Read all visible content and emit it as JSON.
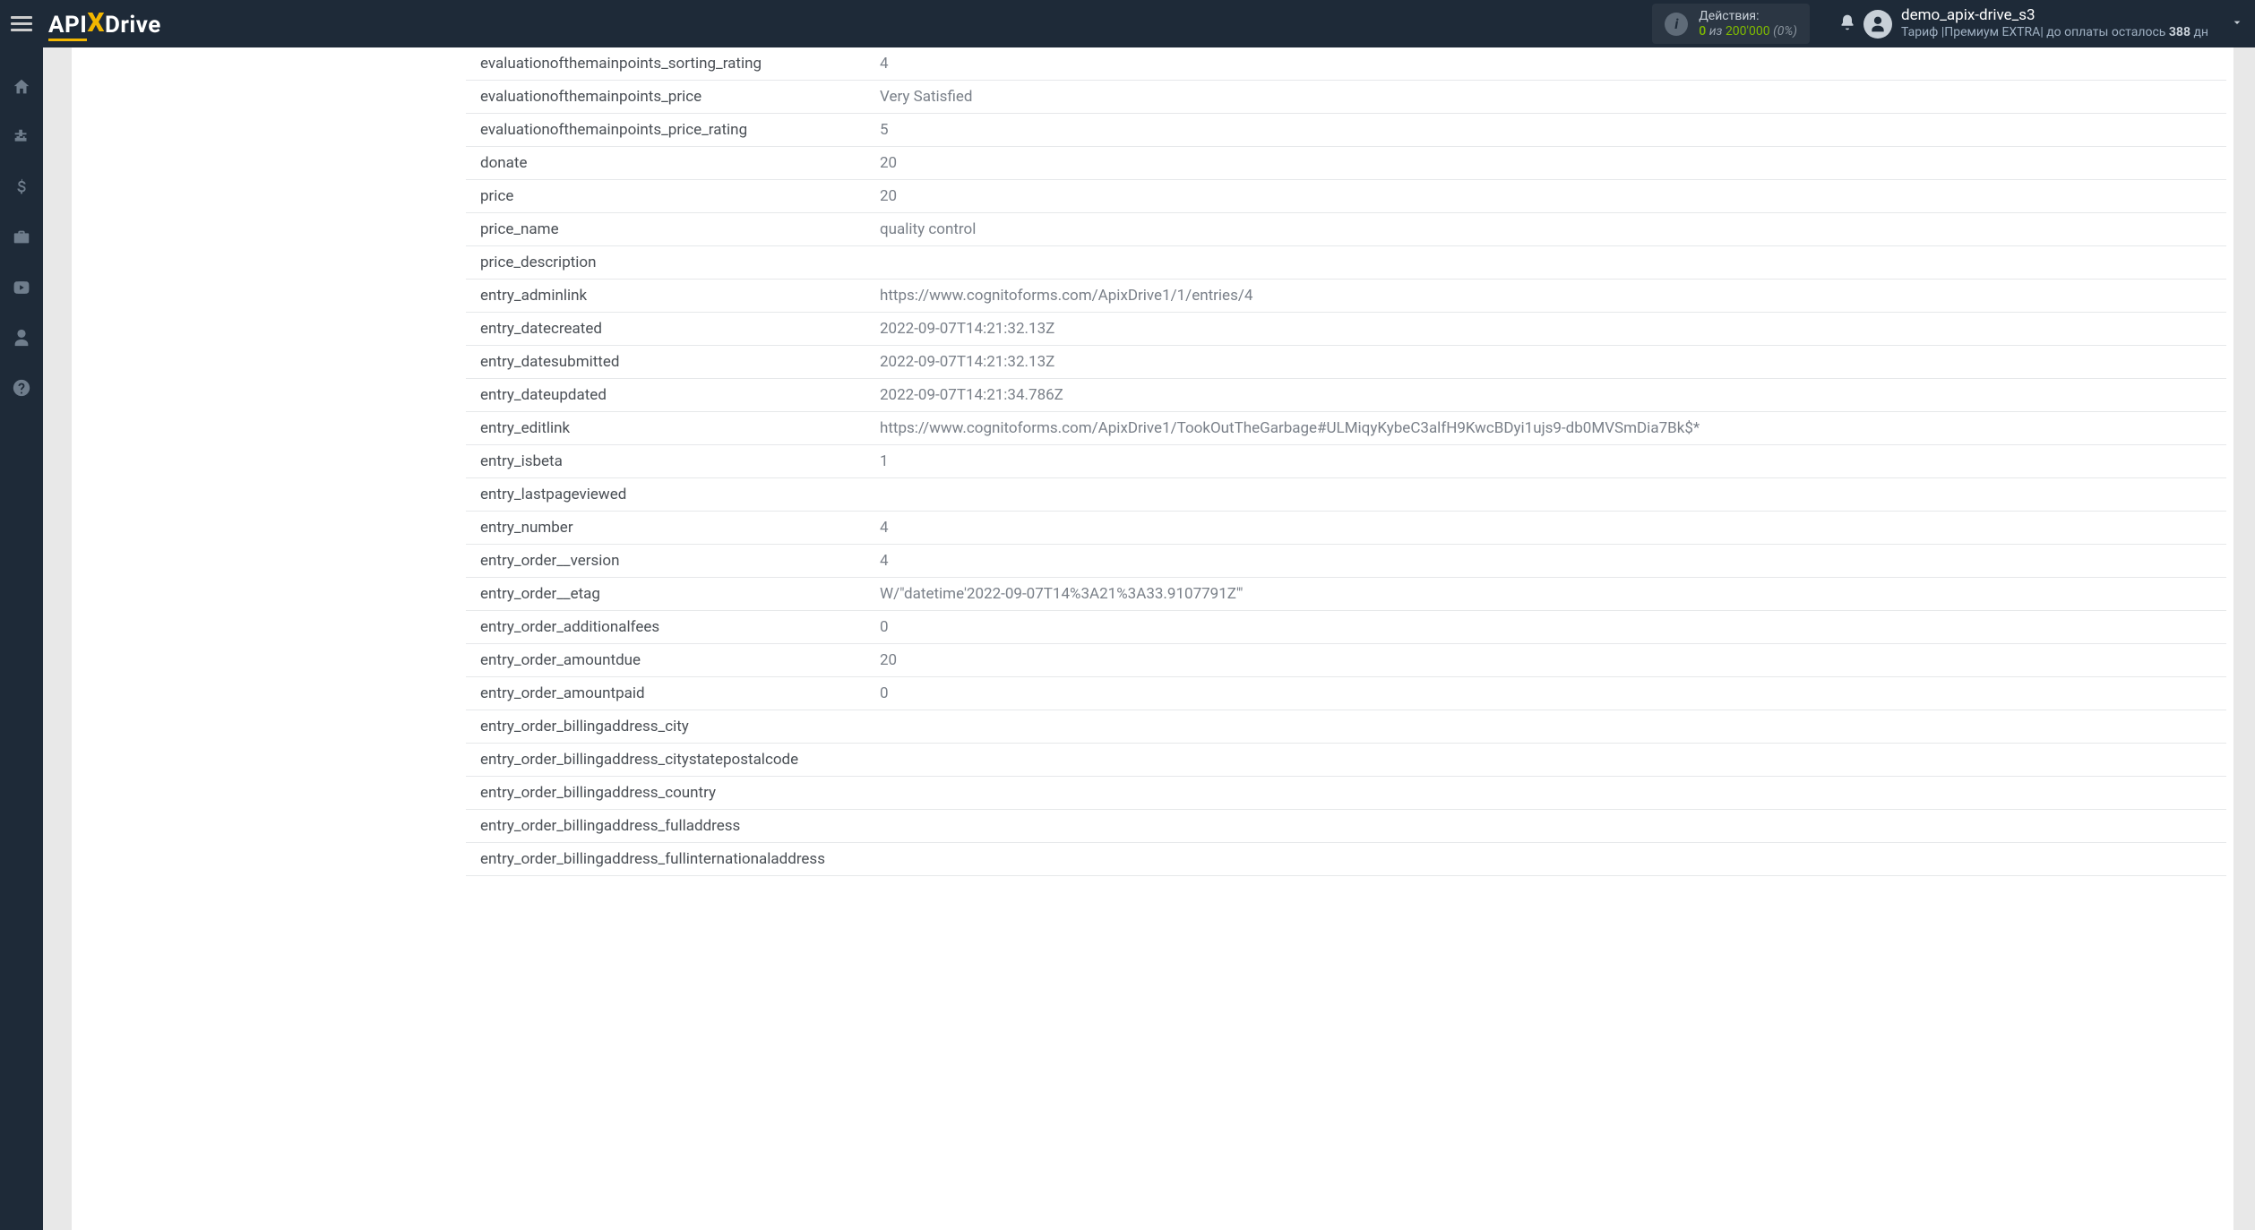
{
  "header": {
    "logo_api": "API",
    "logo_drive": "Drive",
    "actions_label": "Действия:",
    "actions_used": "0",
    "actions_iz": "из",
    "actions_total": "200'000",
    "actions_pct": "(0%)",
    "user_name": "demo_apix-drive_s3",
    "tariff_prefix": "Тариф |",
    "tariff_name": "Премиум EXTRA",
    "tariff_mid": "| до оплаты осталось ",
    "tariff_days": "388",
    "tariff_suffix": " дн"
  },
  "rows": [
    {
      "key": "evaluationofthemainpoints_sorting_rating",
      "val": "4"
    },
    {
      "key": "evaluationofthemainpoints_price",
      "val": "Very Satisfied"
    },
    {
      "key": "evaluationofthemainpoints_price_rating",
      "val": "5"
    },
    {
      "key": "donate",
      "val": "20"
    },
    {
      "key": "price",
      "val": "20"
    },
    {
      "key": "price_name",
      "val": "quality control"
    },
    {
      "key": "price_description",
      "val": ""
    },
    {
      "key": "entry_adminlink",
      "val": "https://www.cognitoforms.com/ApixDrive1/1/entries/4"
    },
    {
      "key": "entry_datecreated",
      "val": "2022-09-07T14:21:32.13Z"
    },
    {
      "key": "entry_datesubmitted",
      "val": "2022-09-07T14:21:32.13Z"
    },
    {
      "key": "entry_dateupdated",
      "val": "2022-09-07T14:21:34.786Z"
    },
    {
      "key": "entry_editlink",
      "val": "https://www.cognitoforms.com/ApixDrive1/TookOutTheGarbage#ULMiqyKybeC3alfH9KwcBDyi1ujs9-db0MVSmDia7Bk$*"
    },
    {
      "key": "entry_isbeta",
      "val": "1"
    },
    {
      "key": "entry_lastpageviewed",
      "val": ""
    },
    {
      "key": "entry_number",
      "val": "4"
    },
    {
      "key": "entry_order__version",
      "val": "4"
    },
    {
      "key": "entry_order__etag",
      "val": "W/\"datetime'2022-09-07T14%3A21%3A33.9107791Z'\""
    },
    {
      "key": "entry_order_additionalfees",
      "val": "0"
    },
    {
      "key": "entry_order_amountdue",
      "val": "20"
    },
    {
      "key": "entry_order_amountpaid",
      "val": "0"
    },
    {
      "key": "entry_order_billingaddress_city",
      "val": ""
    },
    {
      "key": "entry_order_billingaddress_citystatepostalcode",
      "val": ""
    },
    {
      "key": "entry_order_billingaddress_country",
      "val": ""
    },
    {
      "key": "entry_order_billingaddress_fulladdress",
      "val": ""
    },
    {
      "key": "entry_order_billingaddress_fullinternationaladdress",
      "val": ""
    }
  ]
}
